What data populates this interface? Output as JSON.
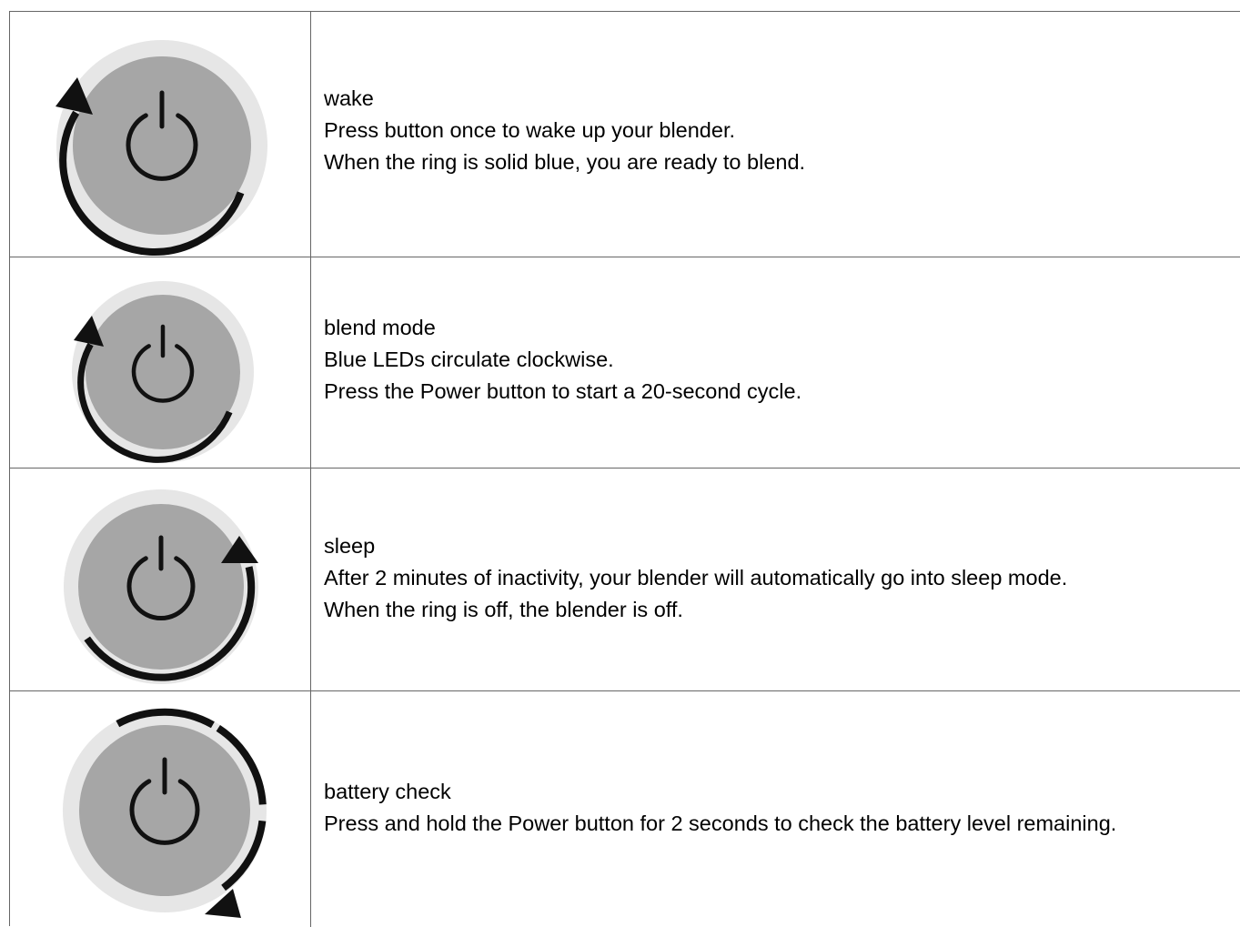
{
  "rows": [
    {
      "title": "wake",
      "lines": [
        "Press button once to wake up your blender.",
        "When the ring is solid blue, you are ready to blend."
      ]
    },
    {
      "title": "blend mode",
      "lines": [
        "Blue LEDs circulate clockwise.",
        "Press the Power button to start a 20-second cycle."
      ]
    },
    {
      "title": "sleep",
      "lines": [
        "After 2 minutes of inactivity, your blender will automatically go into sleep mode.",
        "When the ring is off, the blender is off."
      ]
    },
    {
      "title": "battery check",
      "lines": [
        "Press and hold the Power button for 2 seconds to check the battery level remaining."
      ]
    }
  ],
  "colors": {
    "ring_outer": "#e6e6e6",
    "button_face": "#a6a6a6",
    "symbol": "#111111",
    "border": "#666666"
  }
}
